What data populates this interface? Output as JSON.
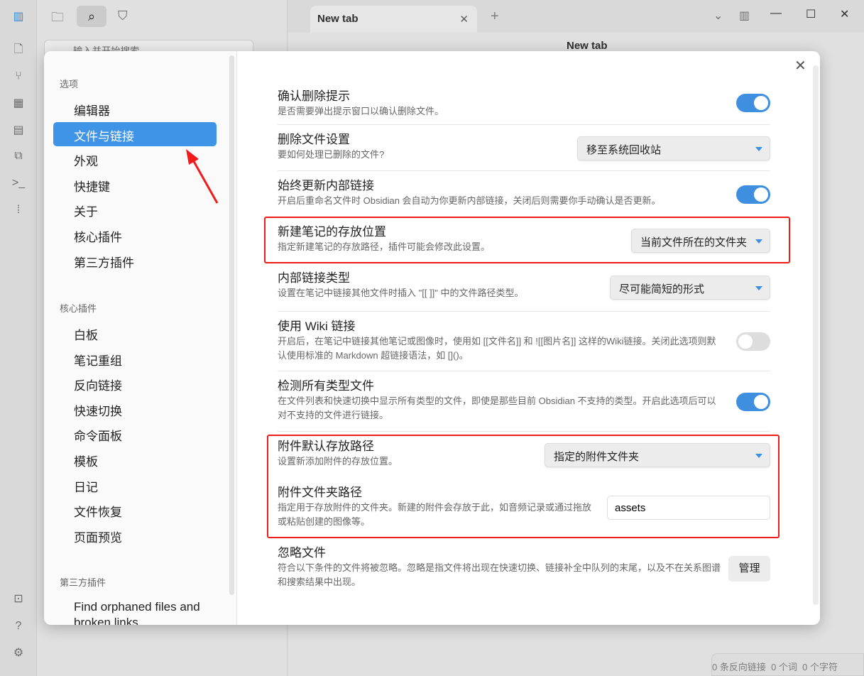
{
  "tabs": {
    "active": "New tab",
    "header_title": "New tab"
  },
  "search": {
    "placeholder": "输入并开始搜索..."
  },
  "status_bar": {
    "backlinks": "0 条反向链接",
    "words": "0 个词",
    "chars": "0 个字符"
  },
  "nav": {
    "sections": [
      {
        "title": "选项",
        "items": [
          "编辑器",
          "文件与链接",
          "外观",
          "快捷键",
          "关于",
          "核心插件",
          "第三方插件"
        ]
      },
      {
        "title": "核心插件",
        "items": [
          "白板",
          "笔记重组",
          "反向链接",
          "快速切换",
          "命令面板",
          "模板",
          "日记",
          "文件恢复",
          "页面预览"
        ]
      },
      {
        "title": "第三方插件",
        "items": [
          "Find orphaned files and broken links"
        ]
      }
    ],
    "active": "文件与链接"
  },
  "settings": [
    {
      "title": "确认删除提示",
      "desc": "是否需要弹出提示窗口以确认删除文件。",
      "control": "toggle",
      "on": true
    },
    {
      "title": "删除文件设置",
      "desc": "要如何处理已删除的文件?",
      "control": "select",
      "value": "移至系统回收站"
    },
    {
      "title": "始终更新内部链接",
      "desc": "开启后重命名文件时 Obsidian 会自动为你更新内部链接，关闭后则需要你手动确认是否更新。",
      "control": "toggle",
      "on": true
    },
    {
      "title": "新建笔记的存放位置",
      "desc": "指定新建笔记的存放路径，插件可能会修改此设置。",
      "control": "select",
      "value": "当前文件所在的文件夹"
    },
    {
      "title": "内部链接类型",
      "desc": "设置在笔记中链接其他文件时插入 \"[[ ]]\" 中的文件路径类型。",
      "control": "select",
      "value": "尽可能简短的形式"
    },
    {
      "title": "使用 Wiki 链接",
      "desc": "开启后，在笔记中链接其他笔记或图像时，使用如 [[文件名]] 和 ![[图片名]] 这样的Wiki链接。关闭此选项则默认使用标准的 Markdown 超链接语法，如 []()。",
      "control": "toggle",
      "on": false
    },
    {
      "title": "检测所有类型文件",
      "desc": "在文件列表和快速切换中显示所有类型的文件，即使是那些目前 Obsidian 不支持的类型。开启此选项后可以对不支持的文件进行链接。",
      "control": "toggle",
      "on": true
    },
    {
      "title": "附件默认存放路径",
      "desc": "设置新添加附件的存放位置。",
      "control": "select",
      "value": "指定的附件文件夹"
    },
    {
      "title": "附件文件夹路径",
      "desc": "指定用于存放附件的文件夹。新建的附件会存放于此，如音频记录或通过拖放或粘贴创建的图像等。",
      "control": "input",
      "value": "assets"
    },
    {
      "title": "忽略文件",
      "desc": "符合以下条件的文件将被忽略。忽略是指文件将出现在快速切换、链接补全中队列的末尾，以及不在关系图谱和搜索结果中出现。",
      "control": "button",
      "value": "管理"
    }
  ],
  "colors": {
    "accent": "#3f94e8",
    "highlight": "#f01c1c"
  }
}
